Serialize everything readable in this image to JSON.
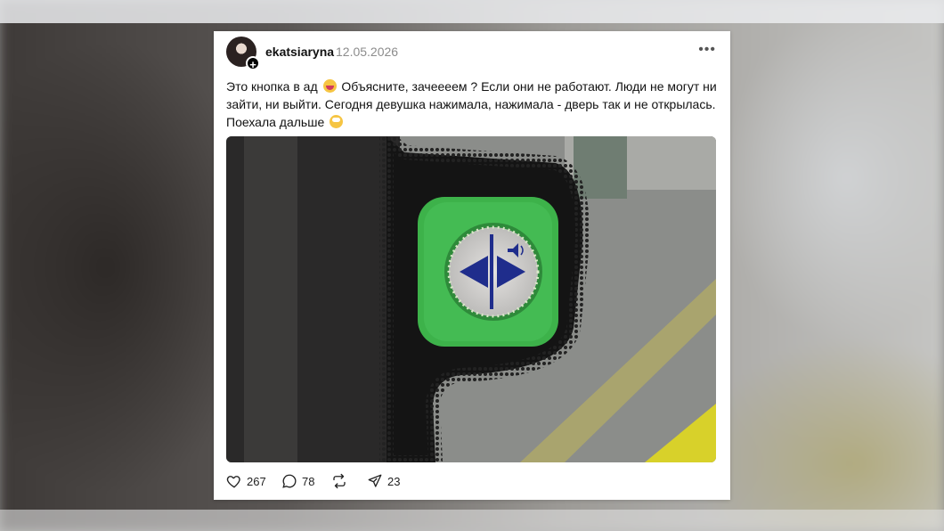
{
  "post": {
    "username": "ekatsiaryna",
    "date": "12.05.2026",
    "text_part1": "Это кнопка в ад",
    "text_part2": "Объясните, зачеееем ? Если они не работают. Люди не могут ни зайти, ни выйти. Сегодня девушка нажимала, нажимала - дверь так и не открылась. Поехала дальше",
    "emoji_1": "laughing-face-icon",
    "emoji_2": "eye-roll-face-icon"
  },
  "actions": {
    "likes": "267",
    "comments": "78",
    "reposts": "",
    "shares": "23"
  },
  "colors": {
    "button_green": "#3db24a",
    "arrow_blue": "#1f2d8c",
    "bus_yellow": "#d8d12a"
  }
}
